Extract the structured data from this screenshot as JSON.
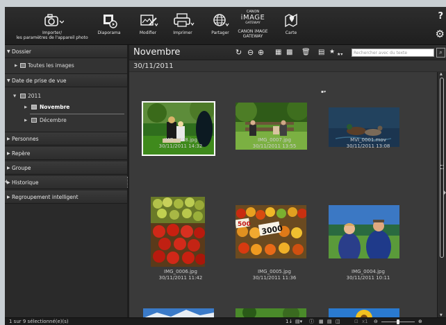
{
  "toolbar": {
    "import_label_1": "Importer/",
    "import_label_2": "les paramètres de l'appareil photo",
    "slideshow_label": "Diaporama",
    "edit_label": "Modifier",
    "print_label": "Imprimer",
    "share_label": "Partager",
    "canon_brand_1": "CANON",
    "canon_brand_2": "iMAGE",
    "canon_brand_3": "GATEWAY",
    "canon_label_1": "CANON iMAGE",
    "canon_label_2": "GATEWAY",
    "map_label": "Carte",
    "help_glyph": "?"
  },
  "sidebar": {
    "folder_header": "Dossier",
    "all_images": "Toutes les images",
    "date_header": "Date de prise de vue",
    "year": "2011",
    "month_selected": "Novembre",
    "month_other": "Décembre",
    "people": "Personnes",
    "marker": "Repère",
    "group": "Groupe",
    "history": "Historique",
    "smart_group": "Regroupement intelligent"
  },
  "main": {
    "title": "Novembre",
    "date_heading": "30/11/2011",
    "search_placeholder": "Rechercher avec du texte"
  },
  "thumbnails": [
    {
      "name": "IMG_0008.jpg",
      "date": "30/11/2011 14:32",
      "selected": true
    },
    {
      "name": "IMG_0007.jpg",
      "date": "30/11/2011 13:55",
      "selected": false
    },
    {
      "name": "MVI_0001.mov",
      "date": "30/11/2011 13:08",
      "selected": false
    },
    {
      "name": "IMG_0006.jpg",
      "date": "30/11/2011 11:42",
      "selected": false
    },
    {
      "name": "IMG_0005.jpg",
      "date": "30/11/2011 11:36",
      "selected": false
    },
    {
      "name": "IMG_0004.jpg",
      "date": "30/11/2011 10:11",
      "selected": false
    }
  ],
  "sign_labels": {
    "left": "500",
    "center": "3000"
  },
  "status": {
    "selection_text": "1 sur 9 sélectionné(e)(s)",
    "sort_glyph": "1↓",
    "zoom_label": "x1"
  },
  "colors": {
    "window_bg": "#2b2b2b",
    "panel_bg": "#3a3a3a",
    "selection_outline": "#ffffff"
  }
}
